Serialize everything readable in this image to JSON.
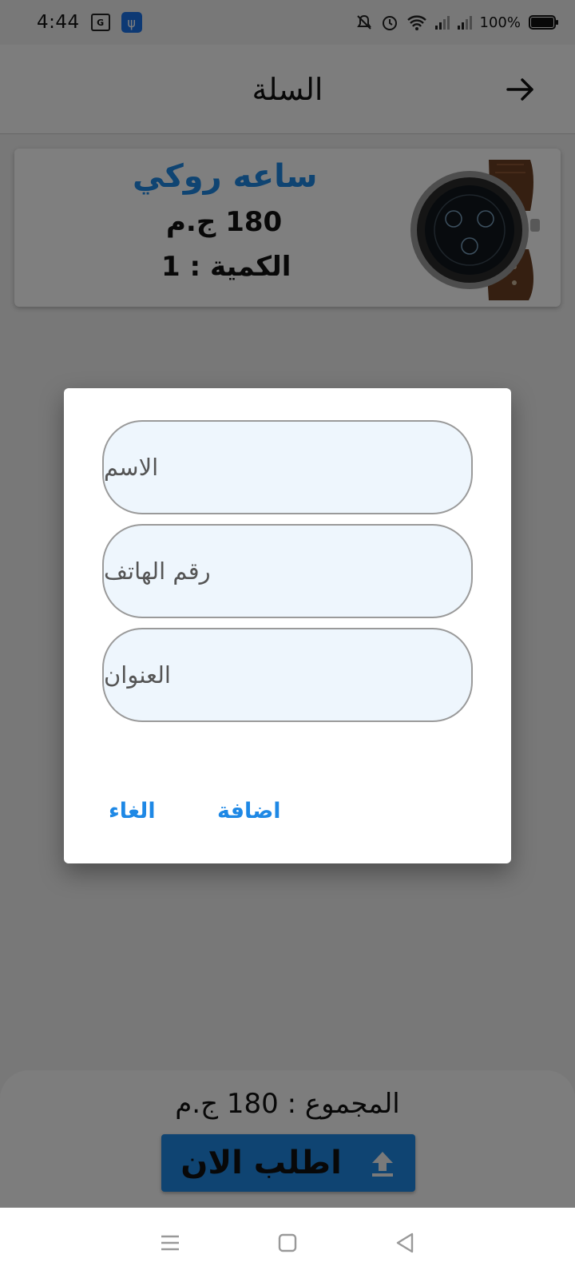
{
  "status_bar": {
    "time": "4:44",
    "battery_percent": "100%",
    "icons": [
      "translate-icon",
      "usb-icon",
      "mute-icon",
      "alarm-icon",
      "wifi-icon",
      "signal-icon",
      "signal-icon",
      "battery-icon"
    ]
  },
  "app_bar": {
    "title": "السلة",
    "back_icon": "arrow-right-icon"
  },
  "cart": {
    "items": [
      {
        "name": "ساعه روكي",
        "price": "180 ج.م",
        "quantity": "الكمية : 1",
        "image": "smartwatch-image"
      }
    ]
  },
  "summary": {
    "total": "المجموع : 180 ج.م",
    "order_button": "اطلب الان",
    "order_icon": "upload-icon"
  },
  "dialog": {
    "fields": [
      {
        "placeholder": "الاسم",
        "value": ""
      },
      {
        "placeholder": "رقم الهاتف",
        "value": ""
      },
      {
        "placeholder": "العنوان",
        "value": ""
      }
    ],
    "cancel_label": "الغاء",
    "add_label": "اضافة"
  },
  "nav_bar": {
    "icons": [
      "menu-icon",
      "home-icon",
      "back-icon"
    ]
  },
  "colors": {
    "accent": "#1e88e5",
    "field_bg": "#eef6fd",
    "scrim": "rgba(0,0,0,0.5)"
  }
}
